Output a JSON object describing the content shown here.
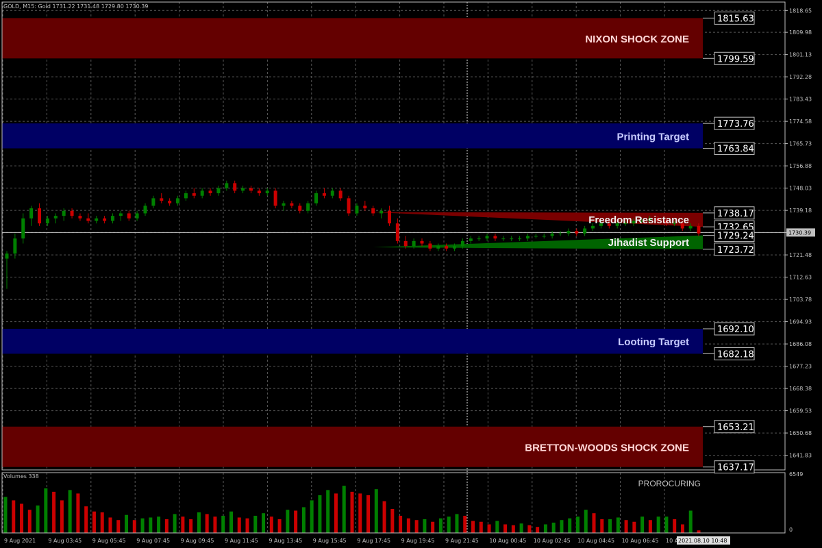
{
  "header": {
    "ohlc_text": "GOLD, M15:  Gold  1731.22 1731.48 1729.80 1730.39",
    "volumes_text": "Volumes 338",
    "indicator_name": "PROROCURING"
  },
  "colors": {
    "background": "#000000",
    "bull": "#008000",
    "bear": "#cc0000",
    "grid": "#5a5a5a",
    "shock_zone": "#640000",
    "target_zone": "#000064",
    "resistance": "#7a0000",
    "support": "#006400",
    "current_price_line": "#c0c0c0"
  },
  "chart_data": {
    "type": "candlestick",
    "symbol": "GOLD",
    "timeframe": "M15",
    "ylim": [
      1636,
      1822
    ],
    "current_price": 1730.39,
    "current_price_label": "1730.39",
    "price_ticks": [
      "1818.65",
      "1809.98",
      "1801.13",
      "1792.28",
      "1783.43",
      "1774.58",
      "1765.73",
      "1756.88",
      "1748.03",
      "1739.18",
      "1730.39",
      "1721.48",
      "1712.63",
      "1703.78",
      "1694.93",
      "1686.08",
      "1677.23",
      "1668.38",
      "1659.53",
      "1650.68",
      "1641.83"
    ],
    "time_labels": [
      "9 Aug 2021",
      "9 Aug 03:45",
      "9 Aug 05:45",
      "9 Aug 07:45",
      "9 Aug 09:45",
      "9 Aug 11:45",
      "9 Aug 13:45",
      "9 Aug 15:45",
      "9 Aug 17:45",
      "9 Aug 19:45",
      "9 Aug 21:45",
      "10 Aug 00:45",
      "10 Aug 02:45",
      "10 Aug 04:45",
      "10 Aug 06:45",
      "10 Aug 08:45"
    ],
    "crosshair_time_label": "2021.08.10 10:48",
    "zones": [
      {
        "name": "NIXON SHOCK ZONE",
        "top": 1815.63,
        "bottom": 1799.59,
        "top_label": "1815.63",
        "bottom_label": "1799.59",
        "kind": "shock"
      },
      {
        "name": "Printing Target",
        "top": 1773.76,
        "bottom": 1763.84,
        "top_label": "1773.76",
        "bottom_label": "1763.84",
        "kind": "target"
      },
      {
        "name": "Looting Target",
        "top": 1692.1,
        "bottom": 1682.18,
        "top_label": "1692.10",
        "bottom_label": "1682.18",
        "kind": "target"
      },
      {
        "name": "BRETTON-WOODS SHOCK ZONE",
        "top": 1653.21,
        "bottom": 1637.17,
        "top_label": "1653.21",
        "bottom_label": "1637.17",
        "kind": "shock"
      }
    ],
    "channels": [
      {
        "name": "Freedom Resistance",
        "start_price": 1738.5,
        "end_top": 1738.17,
        "end_bottom": 1732.65,
        "top_label": "1738.17",
        "bottom_label": "1732.65",
        "kind": "resistance"
      },
      {
        "name": "Jihadist Support",
        "start_price": 1724.5,
        "end_top": 1729.24,
        "end_bottom": 1723.72,
        "top_label": "1729.24",
        "bottom_label": "1723.72",
        "kind": "support"
      }
    ],
    "candles": [
      [
        1720,
        1723,
        1708,
        1722
      ],
      [
        1722,
        1730,
        1720,
        1728
      ],
      [
        1728,
        1738,
        1726,
        1736
      ],
      [
        1736,
        1741,
        1733,
        1740
      ],
      [
        1740,
        1742,
        1733,
        1734
      ],
      [
        1734,
        1737,
        1733,
        1736
      ],
      [
        1736,
        1738,
        1734,
        1737
      ],
      [
        1737,
        1740,
        1735,
        1739
      ],
      [
        1739,
        1740,
        1736,
        1737
      ],
      [
        1737,
        1738,
        1735,
        1736
      ],
      [
        1736,
        1738,
        1734,
        1735
      ],
      [
        1735,
        1737,
        1734,
        1736
      ],
      [
        1736,
        1737,
        1734,
        1735
      ],
      [
        1735,
        1738,
        1734,
        1737
      ],
      [
        1737,
        1739,
        1735,
        1738
      ],
      [
        1738,
        1739,
        1735,
        1736
      ],
      [
        1736,
        1739,
        1735,
        1738
      ],
      [
        1738,
        1742,
        1737,
        1741
      ],
      [
        1741,
        1745,
        1740,
        1744
      ],
      [
        1744,
        1746,
        1742,
        1743
      ],
      [
        1743,
        1744,
        1741,
        1742
      ],
      [
        1742,
        1745,
        1741,
        1744
      ],
      [
        1744,
        1747,
        1743,
        1746
      ],
      [
        1746,
        1748,
        1744,
        1745
      ],
      [
        1745,
        1748,
        1744,
        1747
      ],
      [
        1747,
        1748,
        1745,
        1746
      ],
      [
        1746,
        1749,
        1745,
        1748
      ],
      [
        1748,
        1751,
        1747,
        1750
      ],
      [
        1750,
        1751,
        1746,
        1747
      ],
      [
        1747,
        1749,
        1746,
        1748
      ],
      [
        1748,
        1749,
        1746,
        1747
      ],
      [
        1747,
        1748,
        1745,
        1746
      ],
      [
        1746,
        1748,
        1745,
        1747
      ],
      [
        1747,
        1748,
        1740,
        1741
      ],
      [
        1741,
        1743,
        1739,
        1742
      ],
      [
        1742,
        1743,
        1740,
        1741
      ],
      [
        1741,
        1742,
        1738,
        1739
      ],
      [
        1739,
        1743,
        1738,
        1742
      ],
      [
        1742,
        1747,
        1741,
        1746
      ],
      [
        1746,
        1748,
        1744,
        1745
      ],
      [
        1745,
        1748,
        1744,
        1747
      ],
      [
        1747,
        1748,
        1743,
        1744
      ],
      [
        1744,
        1745,
        1737,
        1738
      ],
      [
        1738,
        1742,
        1737,
        1741
      ],
      [
        1741,
        1743,
        1739,
        1740
      ],
      [
        1740,
        1741,
        1737,
        1738
      ],
      [
        1738,
        1740,
        1736,
        1739
      ],
      [
        1739,
        1741,
        1733,
        1734
      ],
      [
        1734,
        1736,
        1726,
        1727
      ],
      [
        1727,
        1729,
        1724,
        1725
      ],
      [
        1725,
        1728,
        1724,
        1727
      ],
      [
        1727,
        1728,
        1725,
        1726
      ],
      [
        1726,
        1727,
        1723,
        1724
      ],
      [
        1724,
        1726,
        1723,
        1725
      ],
      [
        1725,
        1726,
        1723,
        1724
      ],
      [
        1724,
        1726,
        1723,
        1725
      ],
      [
        1725,
        1728,
        1724,
        1727
      ],
      [
        1727,
        1729,
        1726,
        1728
      ],
      [
        1728,
        1729,
        1727,
        1728
      ],
      [
        1728,
        1730,
        1727,
        1729
      ],
      [
        1729,
        1730,
        1727,
        1728
      ],
      [
        1728,
        1729,
        1727,
        1728
      ],
      [
        1728,
        1729,
        1727,
        1728
      ],
      [
        1728,
        1729,
        1727,
        1728
      ],
      [
        1728,
        1730,
        1727,
        1729
      ],
      [
        1729,
        1730,
        1728,
        1729
      ],
      [
        1729,
        1730,
        1728,
        1729
      ],
      [
        1729,
        1731,
        1728,
        1730
      ],
      [
        1730,
        1731,
        1729,
        1730
      ],
      [
        1730,
        1732,
        1729,
        1731
      ],
      [
        1731,
        1732,
        1729,
        1730
      ],
      [
        1730,
        1733,
        1729,
        1732
      ],
      [
        1732,
        1734,
        1731,
        1733
      ],
      [
        1733,
        1735,
        1732,
        1734
      ],
      [
        1734,
        1735,
        1732,
        1733
      ],
      [
        1733,
        1735,
        1732,
        1734
      ],
      [
        1734,
        1735,
        1733,
        1734
      ],
      [
        1734,
        1736,
        1733,
        1735
      ],
      [
        1735,
        1736,
        1734,
        1735
      ],
      [
        1735,
        1737,
        1734,
        1736
      ],
      [
        1736,
        1737,
        1734,
        1735
      ],
      [
        1735,
        1736,
        1733,
        1734
      ],
      [
        1734,
        1735,
        1733,
        1734
      ],
      [
        1734,
        1735,
        1731,
        1732
      ],
      [
        1732,
        1734,
        1731,
        1733
      ],
      [
        1733,
        1734,
        1729,
        1730
      ]
    ],
    "volume_max_label": "6549",
    "volume_min_label": "0",
    "volume_max": 6549,
    "volumes": [
      4200,
      3800,
      3400,
      2700,
      3200,
      5200,
      4800,
      3800,
      5000,
      4600,
      3100,
      2500,
      2400,
      1800,
      1500,
      2100,
      1500,
      1700,
      1800,
      1900,
      1600,
      2200,
      1900,
      1600,
      2400,
      2200,
      1900,
      2000,
      2500,
      1800,
      1700,
      2000,
      2300,
      1900,
      1600,
      2700,
      2600,
      3000,
      3800,
      4400,
      5000,
      4600,
      5500,
      4800,
      4600,
      4400,
      5100,
      3700,
      2800,
      2000,
      1700,
      1500,
      1600,
      1300,
      1700,
      1900,
      2200,
      2000,
      1400,
      1300,
      1000,
      1400,
      1000,
      900,
      1100,
      900,
      700,
      1000,
      1200,
      1500,
      1700,
      1900,
      2700,
      2300,
      1600,
      1600,
      1800,
      1500,
      1300,
      1900,
      1500,
      1900,
      1900,
      1600,
      1000,
      2600,
      300
    ]
  }
}
